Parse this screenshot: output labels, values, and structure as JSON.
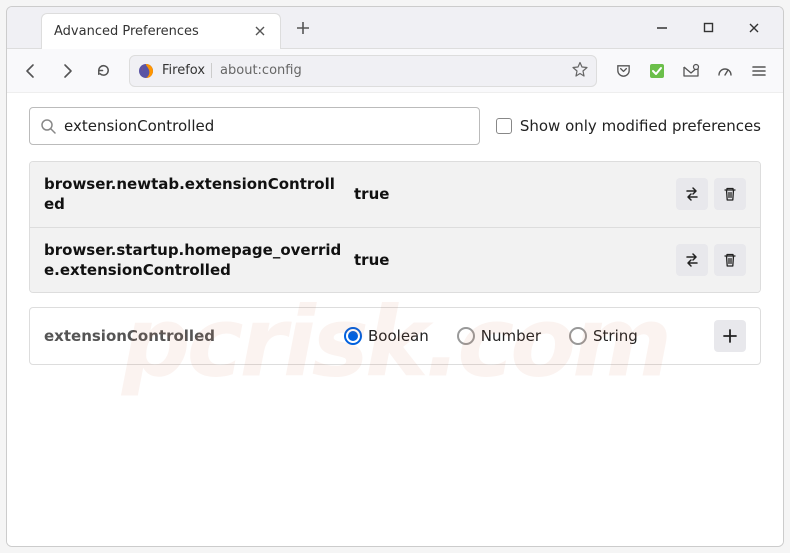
{
  "tab": {
    "title": "Advanced Preferences"
  },
  "urlbar": {
    "identity_label": "Firefox",
    "address": "about:config"
  },
  "search": {
    "value": "extensionControlled",
    "show_only_modified_label": "Show only modified preferences"
  },
  "prefs": [
    {
      "name": "browser.newtab.extensionControlled",
      "value": "true"
    },
    {
      "name": "browser.startup.homepage_override.extensionControlled",
      "value": "true"
    }
  ],
  "new_pref": {
    "name": "extensionControlled",
    "types": {
      "boolean": "Boolean",
      "number": "Number",
      "string": "String"
    }
  },
  "watermark": "pcrisk.com"
}
